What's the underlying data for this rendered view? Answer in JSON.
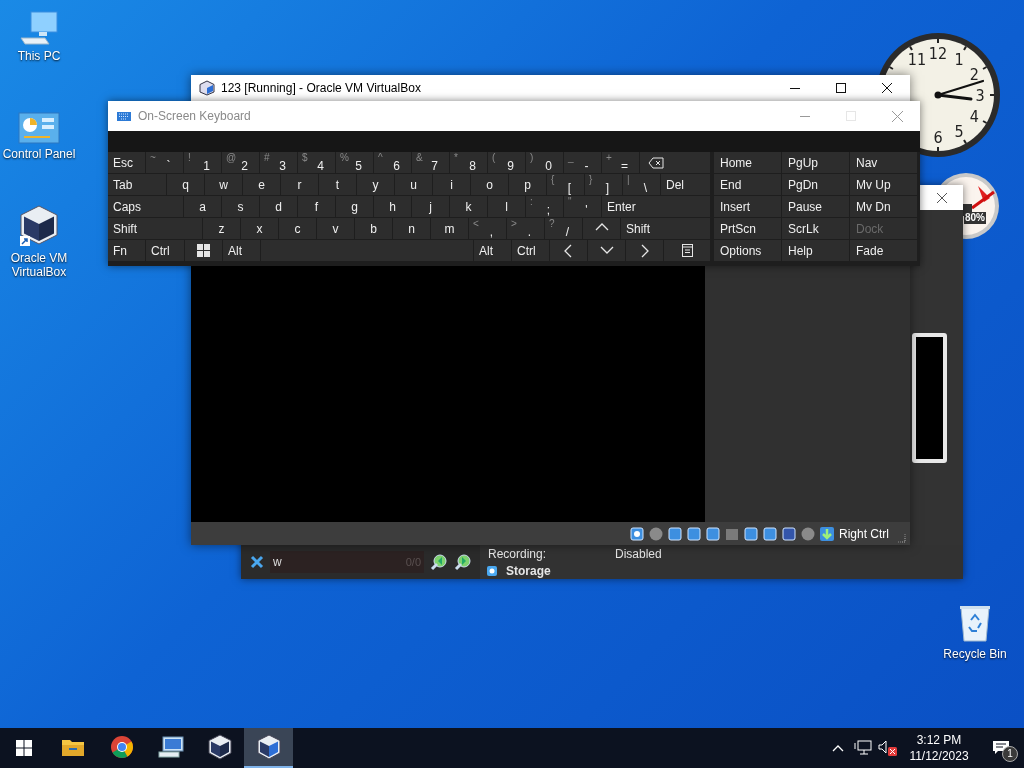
{
  "desktop_icons": [
    {
      "label": "This PC",
      "kind": "pc"
    },
    {
      "label": "Control Panel",
      "kind": "control"
    },
    {
      "label": "Oracle VM VirtualBox",
      "kind": "vbox"
    }
  ],
  "recycle_bin": {
    "label": "Recycle Bin"
  },
  "clock_gadget": {
    "numerals": [
      "12",
      "1",
      "2",
      "3",
      "4",
      "5",
      "6",
      "11"
    ]
  },
  "gauge_gadget": {
    "reading": "80%"
  },
  "manager_window": {
    "search": {
      "value": "w",
      "count": "0/0"
    },
    "details": [
      {
        "label": "Recording:",
        "value": "Disabled"
      }
    ],
    "section": "Storage"
  },
  "vm_window": {
    "title": "123 [Running] - Oracle VM VirtualBox",
    "host_key": "Right Ctrl"
  },
  "keyboard": {
    "title": "On-Screen Keyboard",
    "rows": [
      [
        {
          "kind": "label",
          "label": "Esc"
        },
        {
          "kind": "char",
          "shift": "~",
          "char": "`"
        },
        {
          "kind": "char",
          "shift": "!",
          "char": "1"
        },
        {
          "kind": "char",
          "shift": "@",
          "char": "2"
        },
        {
          "kind": "char",
          "shift": "#",
          "char": "3"
        },
        {
          "kind": "char",
          "shift": "$",
          "char": "4"
        },
        {
          "kind": "char",
          "shift": "%",
          "char": "5"
        },
        {
          "kind": "char",
          "shift": "^",
          "char": "6"
        },
        {
          "kind": "char",
          "shift": "&",
          "char": "7"
        },
        {
          "kind": "char",
          "shift": "*",
          "char": "8"
        },
        {
          "kind": "char",
          "shift": "(",
          "char": "9"
        },
        {
          "kind": "char",
          "shift": ")",
          "char": "0"
        },
        {
          "kind": "char",
          "shift": "_",
          "char": "-"
        },
        {
          "kind": "char",
          "shift": "+",
          "char": "="
        },
        {
          "kind": "backspace"
        }
      ],
      [
        {
          "kind": "label",
          "label": "Tab"
        },
        {
          "kind": "letter",
          "char": "q"
        },
        {
          "kind": "letter",
          "char": "w"
        },
        {
          "kind": "letter",
          "char": "e"
        },
        {
          "kind": "letter",
          "char": "r"
        },
        {
          "kind": "letter",
          "char": "t"
        },
        {
          "kind": "letter",
          "char": "y"
        },
        {
          "kind": "letter",
          "char": "u"
        },
        {
          "kind": "letter",
          "char": "i"
        },
        {
          "kind": "letter",
          "char": "o"
        },
        {
          "kind": "letter",
          "char": "p"
        },
        {
          "kind": "char",
          "shift": "{",
          "char": "["
        },
        {
          "kind": "char",
          "shift": "}",
          "char": "]"
        },
        {
          "kind": "char",
          "shift": "|",
          "char": "\\"
        },
        {
          "kind": "label",
          "label": "Del"
        }
      ],
      [
        {
          "kind": "label",
          "label": "Caps"
        },
        {
          "kind": "letter",
          "char": "a"
        },
        {
          "kind": "letter",
          "char": "s"
        },
        {
          "kind": "letter",
          "char": "d"
        },
        {
          "kind": "letter",
          "char": "f"
        },
        {
          "kind": "letter",
          "char": "g"
        },
        {
          "kind": "letter",
          "char": "h"
        },
        {
          "kind": "letter",
          "char": "j"
        },
        {
          "kind": "letter",
          "char": "k"
        },
        {
          "kind": "letter",
          "char": "l"
        },
        {
          "kind": "char",
          "shift": ":",
          "char": ";"
        },
        {
          "kind": "char",
          "shift": "\"",
          "char": "'"
        },
        {
          "kind": "label",
          "label": "Enter"
        }
      ],
      [
        {
          "kind": "label",
          "label": "Shift"
        },
        {
          "kind": "letter",
          "char": "z"
        },
        {
          "kind": "letter",
          "char": "x"
        },
        {
          "kind": "letter",
          "char": "c"
        },
        {
          "kind": "letter",
          "char": "v"
        },
        {
          "kind": "letter",
          "char": "b"
        },
        {
          "kind": "letter",
          "char": "n"
        },
        {
          "kind": "letter",
          "char": "m"
        },
        {
          "kind": "char",
          "shift": "<",
          "char": ","
        },
        {
          "kind": "char",
          "shift": ">",
          "char": "."
        },
        {
          "kind": "char",
          "shift": "?",
          "char": "/"
        },
        {
          "kind": "up"
        },
        {
          "kind": "label",
          "label": "Shift"
        }
      ],
      [
        {
          "kind": "label",
          "label": "Fn"
        },
        {
          "kind": "label",
          "label": "Ctrl"
        },
        {
          "kind": "windows"
        },
        {
          "kind": "label",
          "label": "Alt"
        },
        {
          "kind": "space"
        },
        {
          "kind": "label",
          "label": "Alt"
        },
        {
          "kind": "label",
          "label": "Ctrl"
        },
        {
          "kind": "left"
        },
        {
          "kind": "down"
        },
        {
          "kind": "right"
        },
        {
          "kind": "menu"
        }
      ]
    ],
    "nav": [
      [
        {
          "label": "Home",
          "disabled": false
        },
        {
          "label": "PgUp",
          "disabled": false
        },
        {
          "label": "Nav",
          "disabled": false
        }
      ],
      [
        {
          "label": "End",
          "disabled": false
        },
        {
          "label": "PgDn",
          "disabled": false
        },
        {
          "label": "Mv Up",
          "disabled": false
        }
      ],
      [
        {
          "label": "Insert",
          "disabled": false
        },
        {
          "label": "Pause",
          "disabled": false
        },
        {
          "label": "Mv Dn",
          "disabled": false
        }
      ],
      [
        {
          "label": "PrtScn",
          "disabled": false
        },
        {
          "label": "ScrLk",
          "disabled": false
        },
        {
          "label": "Dock",
          "disabled": true
        }
      ],
      [
        {
          "label": "Options",
          "disabled": false
        },
        {
          "label": "Help",
          "disabled": false
        },
        {
          "label": "Fade",
          "disabled": false
        }
      ]
    ]
  },
  "taskbar": {
    "apps": [
      {
        "kind": "explorer",
        "selected": false
      },
      {
        "kind": "browser",
        "selected": false
      },
      {
        "kind": "monitor",
        "selected": false
      },
      {
        "kind": "cube",
        "selected": false
      },
      {
        "kind": "running",
        "selected": true
      }
    ],
    "time": "3:12 PM",
    "date": "11/12/2023",
    "notifications": "1"
  }
}
